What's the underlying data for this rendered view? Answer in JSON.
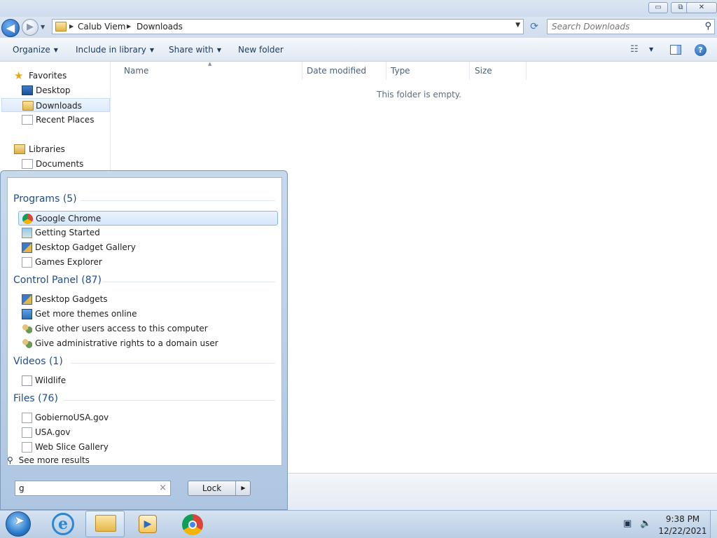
{
  "window": {
    "caption_minimize": "▭",
    "caption_maximize": "⧉",
    "caption_close": "✕"
  },
  "address": {
    "crumbs": [
      "Calub Viem",
      "Downloads"
    ]
  },
  "search": {
    "placeholder": "Search Downloads"
  },
  "toolbar": {
    "organize": "Organize",
    "include_in_library": "Include in library",
    "share_with": "Share with",
    "new_folder": "New folder"
  },
  "nav": {
    "favorites": "Favorites",
    "desktop": "Desktop",
    "downloads": "Downloads",
    "recent_places": "Recent Places",
    "libraries": "Libraries",
    "documents": "Documents"
  },
  "columns": {
    "name": "Name",
    "date_modified": "Date modified",
    "type": "Type",
    "size": "Size"
  },
  "content": {
    "empty_message": "This folder is empty."
  },
  "startmenu": {
    "groups": [
      {
        "title": "Programs (5)",
        "items": [
          "Google Chrome",
          "Getting Started",
          "Desktop Gadget Gallery",
          "Games Explorer"
        ]
      },
      {
        "title": "Control Panel (87)",
        "items": [
          "Desktop Gadgets",
          "Get more themes online",
          "Give other users access to this computer",
          "Give administrative rights to a domain user"
        ]
      },
      {
        "title": "Videos (1)",
        "items": [
          "Wildlife"
        ]
      },
      {
        "title": "Files (76)",
        "items": [
          "GobiernoUSA.gov",
          "USA.gov",
          "Web Slice Gallery"
        ]
      }
    ],
    "see_more": "See more results",
    "search_value": "g",
    "lock_label": "Lock"
  },
  "tray": {
    "time": "9:38 PM",
    "date": "12/22/2021"
  }
}
